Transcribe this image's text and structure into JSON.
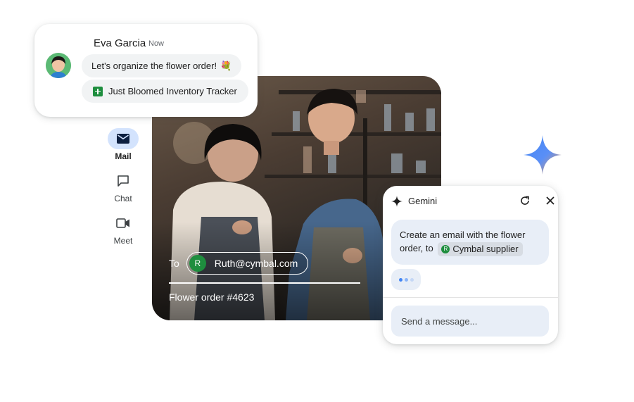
{
  "notification": {
    "sender": "Eva Garcia",
    "time": "Now",
    "message": "Let's organize the flower order!",
    "emoji": "💐",
    "attachment": "Just Bloomed Inventory Tracker"
  },
  "rail": {
    "items": [
      {
        "label": "Mail",
        "icon": "mail-icon",
        "active": true
      },
      {
        "label": "Chat",
        "icon": "chat-icon"
      },
      {
        "label": "Meet",
        "icon": "video-icon"
      }
    ]
  },
  "compose": {
    "to_label": "To",
    "recipient_initial": "R",
    "recipient": "Ruth@cymbal.com",
    "subject": "Flower order #4623"
  },
  "gemini": {
    "title": "Gemini",
    "prompt_text": "Create an email with the flower order, to",
    "chip_initial": "R",
    "chip_label": "Cymbal supplier",
    "input_placeholder": "Send a message..."
  },
  "colors": {
    "accent_blue": "#d3e3fd",
    "gemini_bubble": "#e8eef7",
    "avatar_green": "#1e8e3e"
  }
}
